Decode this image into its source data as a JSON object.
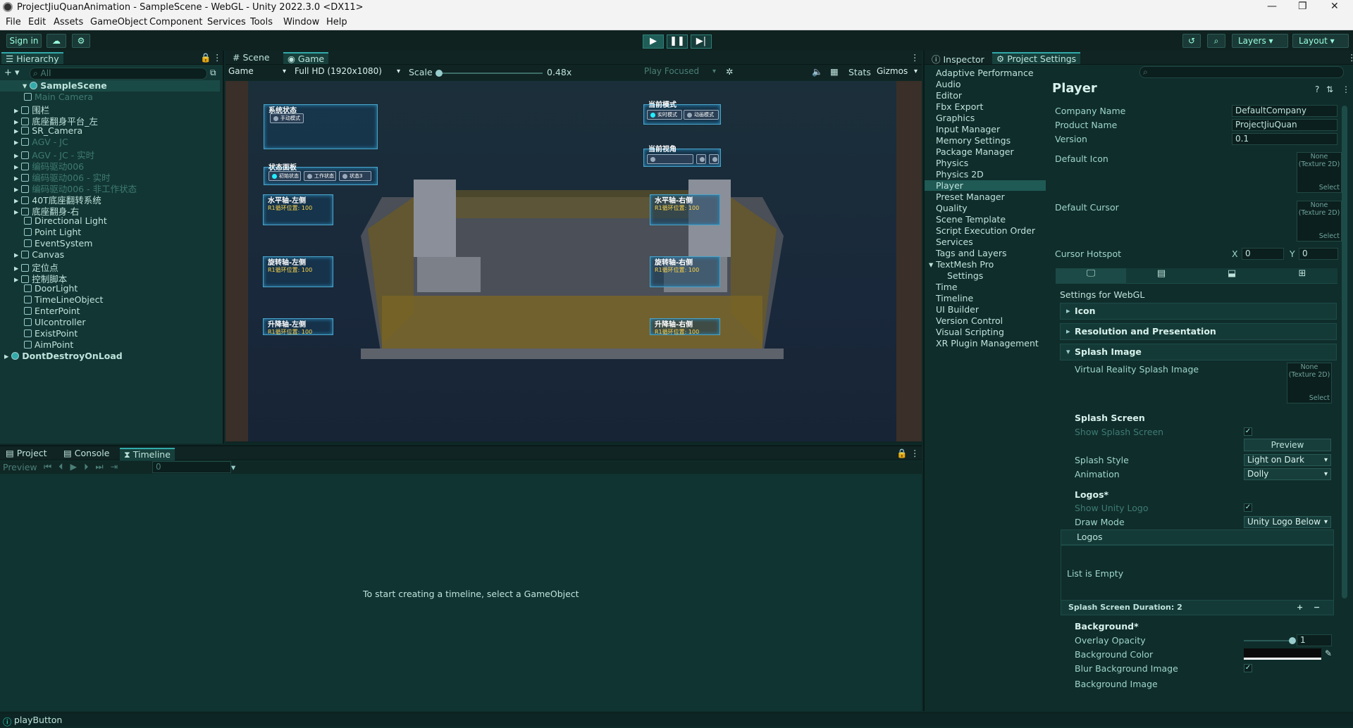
{
  "window": {
    "title": "ProjectJiuQuanAnimation - SampleScene - WebGL - Unity 2022.3.0 <DX11>",
    "min": "—",
    "max": "❐",
    "close": "✕"
  },
  "menu": [
    "File",
    "Edit",
    "Assets",
    "GameObject",
    "Component",
    "Services",
    "Tools",
    "Window",
    "Help"
  ],
  "toolbar": {
    "sign_in": "Sign in",
    "play": "▶",
    "pause": "❚❚",
    "step": "▶|",
    "layers": "Layers",
    "layout": "Layout"
  },
  "hierarchy": {
    "tab": "Hierarchy",
    "search_placeholder": "All",
    "add": "+ ▾",
    "items": [
      {
        "label": "SampleScene",
        "indent": 0,
        "expanded": true,
        "scene": true
      },
      {
        "label": "Main Camera",
        "indent": 2,
        "dim": true
      },
      {
        "label": "围栏",
        "indent": 1,
        "arrow": true
      },
      {
        "label": "底座翻身平台_左",
        "indent": 1,
        "arrow": true
      },
      {
        "label": "SR_Camera",
        "indent": 1,
        "arrow": true
      },
      {
        "label": "AGV - JC",
        "indent": 1,
        "arrow": true,
        "dim": true
      },
      {
        "label": "AGV - JC - 实时",
        "indent": 1,
        "arrow": true,
        "dim": true
      },
      {
        "label": "编码驱动006",
        "indent": 1,
        "arrow": true,
        "dim": true
      },
      {
        "label": "编码驱动006 - 实时",
        "indent": 1,
        "arrow": true,
        "dim": true
      },
      {
        "label": "编码驱动006 - 非工作状态",
        "indent": 1,
        "arrow": true,
        "dim": true
      },
      {
        "label": "40T底座翻转系统",
        "indent": 1,
        "arrow": true
      },
      {
        "label": "底座翻身-右",
        "indent": 1,
        "arrow": true
      },
      {
        "label": "Directional Light",
        "indent": 2
      },
      {
        "label": "Point Light",
        "indent": 2
      },
      {
        "label": "EventSystem",
        "indent": 2
      },
      {
        "label": "Canvas",
        "indent": 1,
        "arrow": true
      },
      {
        "label": "定位点",
        "indent": 1,
        "arrow": true
      },
      {
        "label": "控制脚本",
        "indent": 1,
        "arrow": true
      },
      {
        "label": "DoorLight",
        "indent": 2
      },
      {
        "label": "TimeLineObject",
        "indent": 2
      },
      {
        "label": "EnterPoint",
        "indent": 2
      },
      {
        "label": "UIcontroller",
        "indent": 2
      },
      {
        "label": "ExistPoint",
        "indent": 2
      },
      {
        "label": "AimPoint",
        "indent": 2
      },
      {
        "label": "DontDestroyOnLoad",
        "indent": 0,
        "scene": true
      }
    ]
  },
  "game": {
    "tabs": [
      "Scene",
      "Game"
    ],
    "display": "Game",
    "resolution": "Full HD (1920x1080)",
    "scale_label": "Scale",
    "scale_value": "0.48x",
    "play_focused": "Play Focused",
    "stats": "Stats",
    "gizmos": "Gizmos"
  },
  "hud": {
    "sys_state": "系统状态",
    "manual": "手动模式",
    "panel": "状态面板",
    "s1": "初始状态",
    "s2": "工作状态",
    "s3": "状态3",
    "mode": "当前模式",
    "m1": "实时模式",
    "m2": "动画模式",
    "view": "当前视角",
    "plus": "+",
    "minus": "-",
    "hl": "水平轴-左侧",
    "hr": "水平轴-右侧",
    "rl": "旋转轴-左侧",
    "rr": "旋转轴-右侧",
    "ll": "升降轴-左侧",
    "lr": "升降轴-右侧",
    "pos": "R1循环位置: 100"
  },
  "bottom": {
    "tabs": [
      "Project",
      "Console",
      "Timeline"
    ],
    "preview": "Preview",
    "frame": "0",
    "hint": "To start creating a timeline, select a GameObject"
  },
  "inspector": {
    "tabs": [
      "Inspector",
      "Project Settings"
    ],
    "categories": [
      "Adaptive Performance",
      "Audio",
      "Editor",
      "Fbx Export",
      "Graphics",
      "Input Manager",
      "Memory Settings",
      "Package Manager",
      "Physics",
      "Physics 2D",
      "Player",
      "Preset Manager",
      "Quality",
      "Scene Template",
      "Script Execution Order",
      "Services",
      "Tags and Layers",
      "TextMesh Pro",
      "Settings",
      "Time",
      "Timeline",
      "UI Builder",
      "Version Control",
      "Visual Scripting",
      "XR Plugin Management"
    ],
    "title": "Player",
    "company_label": "Company Name",
    "company": "DefaultCompany",
    "product_label": "Product Name",
    "product": "ProjectJiuQuan",
    "version_label": "Version",
    "version": "0.1",
    "icon_label": "Default Icon",
    "cursor_label": "Default Cursor",
    "tex_none": "None",
    "tex_type": "(Texture 2D)",
    "select": "Select",
    "hotspot_label": "Cursor Hotspot",
    "x": "X",
    "xv": "0",
    "y": "Y",
    "yv": "0",
    "webgl": "Settings for WebGL",
    "sec_icon": "Icon",
    "sec_res": "Resolution and Presentation",
    "sec_splash": "Splash Image",
    "vr_splash": "Virtual Reality Splash Image",
    "splash_screen": "Splash Screen",
    "show_splash": "Show Splash Screen",
    "preview": "Preview",
    "splash_style_label": "Splash Style",
    "splash_style": "Light on Dark",
    "animation_label": "Animation",
    "animation": "Dolly",
    "logos_head": "Logos*",
    "show_unity_logo": "Show Unity Logo",
    "draw_mode_label": "Draw Mode",
    "draw_mode": "Unity Logo Below",
    "logos": "Logos",
    "empty": "List is Empty",
    "duration": "Splash Screen Duration: 2",
    "background": "Background*",
    "overlay_label": "Overlay Opacity",
    "overlay": "1",
    "bgcolor_label": "Background Color",
    "blur_label": "Blur Background Image",
    "bgimage_label": "Background Image"
  },
  "status": {
    "text": "playButton"
  }
}
